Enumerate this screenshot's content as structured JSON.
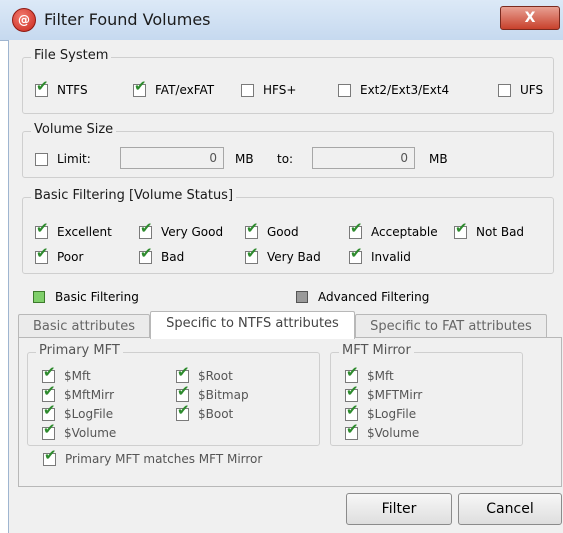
{
  "window": {
    "title": "Filter Found Volumes",
    "close_symbol": "X"
  },
  "file_system": {
    "title": "File System",
    "items": [
      {
        "label": "NTFS",
        "checked": true
      },
      {
        "label": "FAT/exFAT",
        "checked": true
      },
      {
        "label": "HFS+",
        "checked": false
      },
      {
        "label": "Ext2/Ext3/Ext4",
        "checked": false
      },
      {
        "label": "UFS",
        "checked": false
      }
    ]
  },
  "volume_size": {
    "title": "Volume Size",
    "limit_label": "Limit:",
    "limit_checked": false,
    "from_value": "0",
    "from_unit": "MB",
    "to_label": "to:",
    "to_value": "0",
    "to_unit": "MB"
  },
  "basic_filtering_group": {
    "title": "Basic Filtering [Volume Status]",
    "items": [
      {
        "label": "Excellent",
        "checked": true
      },
      {
        "label": "Very Good",
        "checked": true
      },
      {
        "label": "Good",
        "checked": true
      },
      {
        "label": "Acceptable",
        "checked": true
      },
      {
        "label": "Not Bad",
        "checked": true
      },
      {
        "label": "Poor",
        "checked": true
      },
      {
        "label": "Bad",
        "checked": true
      },
      {
        "label": "Very Bad",
        "checked": true
      },
      {
        "label": "Invalid",
        "checked": true
      }
    ]
  },
  "mode": {
    "basic_label": "Basic Filtering",
    "advanced_label": "Advanced Filtering",
    "selected": "basic"
  },
  "tabs": [
    {
      "label": "Basic attributes",
      "active": false
    },
    {
      "label": "Specific to NTFS attributes",
      "active": true
    },
    {
      "label": "Specific to FAT attributes",
      "active": false
    }
  ],
  "primary_mft": {
    "title": "Primary MFT",
    "items": [
      {
        "label": "$Mft",
        "checked": true
      },
      {
        "label": "$MftMirr",
        "checked": true
      },
      {
        "label": "$LogFile",
        "checked": true
      },
      {
        "label": "$Volume",
        "checked": true
      },
      {
        "label": "$Root",
        "checked": true
      },
      {
        "label": "$Bitmap",
        "checked": true
      },
      {
        "label": "$Boot",
        "checked": true
      }
    ]
  },
  "mft_mirror": {
    "title": "MFT Mirror",
    "items": [
      {
        "label": "$Mft",
        "checked": true
      },
      {
        "label": "$MFTMirr",
        "checked": true
      },
      {
        "label": "$LogFile",
        "checked": true
      },
      {
        "label": "$Volume",
        "checked": true
      }
    ]
  },
  "match_option": {
    "label": "Primary MFT matches MFT Mirror",
    "checked": true
  },
  "buttons": {
    "filter": "Filter",
    "cancel": "Cancel"
  },
  "colors": {
    "check": "#2e8b2e",
    "title_bar": "#c6d9ef",
    "close": "#c8412c"
  }
}
